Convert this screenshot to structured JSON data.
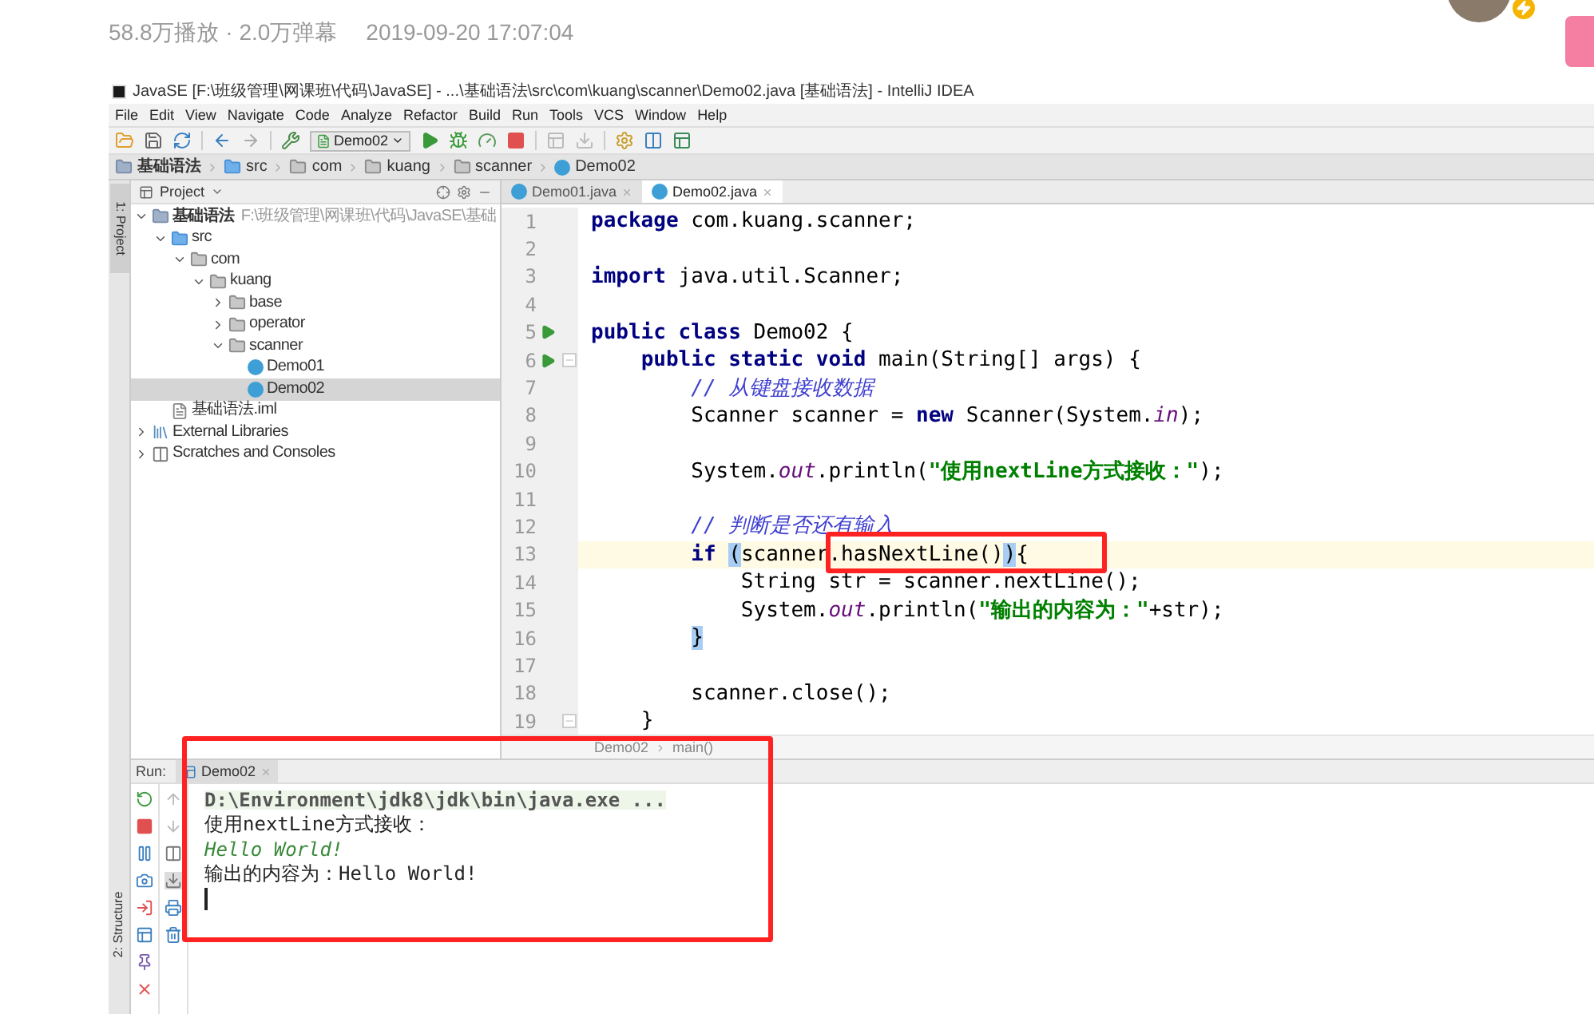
{
  "page_header": {
    "stats": "58.8万播放 · 2.0万弹幕",
    "date": "2019-09-20 17:07:04"
  },
  "window": {
    "title": "JavaSE [F:\\班级管理\\网课班\\代码\\JavaSE] - ...\\基础语法\\src\\com\\kuang\\scanner\\Demo02.java [基础语法] - IntelliJ IDEA"
  },
  "menu": [
    "File",
    "Edit",
    "View",
    "Navigate",
    "Code",
    "Analyze",
    "Refactor",
    "Build",
    "Run",
    "Tools",
    "VCS",
    "Window",
    "Help"
  ],
  "toolbar": {
    "run_config": "Demo02"
  },
  "breadcrumb": [
    {
      "label": "基础语法",
      "kind": "module"
    },
    {
      "label": "src",
      "kind": "source_folder"
    },
    {
      "label": "com",
      "kind": "folder"
    },
    {
      "label": "kuang",
      "kind": "folder"
    },
    {
      "label": "scanner",
      "kind": "folder"
    },
    {
      "label": "Demo02",
      "kind": "class"
    }
  ],
  "tool_strip": [
    "1: Project",
    "2: Structure"
  ],
  "project_panel": {
    "title": "Project",
    "tree": [
      {
        "name": "基础语法",
        "path": "F:\\班级管理\\网课班\\代码\\JavaSE\\基础",
        "kind": "module",
        "expanded": true,
        "selected": false,
        "children": [
          {
            "name": "src",
            "kind": "source_folder",
            "expanded": true,
            "selected": false,
            "children": [
              {
                "name": "com",
                "kind": "folder",
                "expanded": true,
                "selected": false,
                "children": [
                  {
                    "name": "kuang",
                    "kind": "folder",
                    "expanded": true,
                    "selected": false,
                    "children": [
                      {
                        "name": "base",
                        "kind": "folder",
                        "expanded": false,
                        "selected": false
                      },
                      {
                        "name": "operator",
                        "kind": "folder",
                        "expanded": false,
                        "selected": false
                      },
                      {
                        "name": "scanner",
                        "kind": "folder",
                        "expanded": true,
                        "selected": false,
                        "children": [
                          {
                            "name": "Demo01",
                            "kind": "class",
                            "selected": false
                          },
                          {
                            "name": "Demo02",
                            "kind": "class",
                            "selected": true
                          }
                        ]
                      }
                    ]
                  }
                ]
              }
            ]
          },
          {
            "name": "基础语法.iml",
            "kind": "iml",
            "selected": false
          }
        ]
      },
      {
        "name": "External Libraries",
        "kind": "libraries",
        "expanded": false,
        "selected": false
      },
      {
        "name": "Scratches and Consoles",
        "kind": "scratches",
        "expanded": false,
        "selected": false
      }
    ]
  },
  "editor": {
    "tabs": [
      {
        "label": "Demo01.java",
        "selected": false
      },
      {
        "label": "Demo02.java",
        "selected": true
      }
    ],
    "lines": [
      {
        "number": "1",
        "tokens": [
          {
            "kind": "keyword",
            "text": "package"
          },
          {
            "kind": "plain",
            "text": " com.kuang.scanner;"
          }
        ]
      },
      {
        "number": "2"
      },
      {
        "number": "3",
        "tokens": [
          {
            "kind": "keyword",
            "text": "import"
          },
          {
            "kind": "plain",
            "text": " java.util.Scanner;"
          }
        ]
      },
      {
        "number": "4"
      },
      {
        "number": "5",
        "run_marker": true,
        "tokens": [
          {
            "kind": "keyword",
            "text": "public class"
          },
          {
            "kind": "plain",
            "text": " Demo02 {"
          }
        ]
      },
      {
        "number": "6",
        "run_marker": true,
        "fold": true,
        "tokens": [
          {
            "kind": "keyword",
            "text": "    public static void"
          },
          {
            "kind": "plain",
            "text": " main(String[] args) {"
          }
        ]
      },
      {
        "number": "7",
        "tokens": [
          {
            "kind": "comment",
            "text": "        // 从键盘接收数据"
          }
        ]
      },
      {
        "number": "8",
        "tokens": [
          {
            "kind": "plain",
            "text": "        Scanner scanner = "
          },
          {
            "kind": "keyword",
            "text": "new"
          },
          {
            "kind": "plain",
            "text": " Scanner(System."
          },
          {
            "kind": "field",
            "text": "in"
          },
          {
            "kind": "plain",
            "text": ");"
          }
        ]
      },
      {
        "number": "9"
      },
      {
        "number": "10",
        "tokens": [
          {
            "kind": "plain",
            "text": "        System."
          },
          {
            "kind": "field",
            "text": "out"
          },
          {
            "kind": "plain",
            "text": ".println("
          },
          {
            "kind": "string",
            "text": "\"使用nextLine方式接收：\""
          },
          {
            "kind": "plain",
            "text": ");"
          }
        ]
      },
      {
        "number": "11"
      },
      {
        "number": "12",
        "tokens": [
          {
            "kind": "comment",
            "text": "        // 判断是否还有输入"
          }
        ]
      },
      {
        "number": "13",
        "current": true,
        "tokens": [
          {
            "kind": "keyword",
            "text": "        if "
          },
          {
            "kind": "brace_match",
            "text": "("
          },
          {
            "kind": "plain",
            "text": "scanner"
          },
          {
            "kind": "plain",
            "text": ".hasNextLine()"
          },
          {
            "kind": "brace_match",
            "text": ")"
          },
          {
            "kind": "plain",
            "text": "{"
          }
        ]
      },
      {
        "number": "14",
        "tokens": [
          {
            "kind": "plain",
            "text": "            String str = scanner.nextLine();"
          }
        ]
      },
      {
        "number": "15",
        "tokens": [
          {
            "kind": "plain",
            "text": "            System."
          },
          {
            "kind": "field",
            "text": "out"
          },
          {
            "kind": "plain",
            "text": ".println("
          },
          {
            "kind": "string",
            "text": "\"输出的内容为：\""
          },
          {
            "kind": "plain",
            "text": "+str);"
          }
        ]
      },
      {
        "number": "16",
        "tokens": [
          {
            "kind": "brace_match",
            "text": "        }"
          }
        ]
      },
      {
        "number": "17"
      },
      {
        "number": "18",
        "tokens": [
          {
            "kind": "plain",
            "text": "        scanner.close();"
          }
        ]
      },
      {
        "number": "19",
        "fold": true,
        "tokens": [
          {
            "kind": "plain",
            "text": "    }"
          }
        ]
      }
    ],
    "breadcrumb": [
      "Demo02",
      "main()"
    ]
  },
  "run_panel": {
    "label": "Run:",
    "tab": "Demo02",
    "console": [
      {
        "kind": "command",
        "text": "D:\\Environment\\jdk8\\jdk\\bin\\java.exe ..."
      },
      {
        "kind": "output",
        "text": "使用nextLine方式接收："
      },
      {
        "kind": "input",
        "text": "Hello World!"
      },
      {
        "kind": "output",
        "text": "输出的内容为：Hello World!"
      }
    ]
  }
}
